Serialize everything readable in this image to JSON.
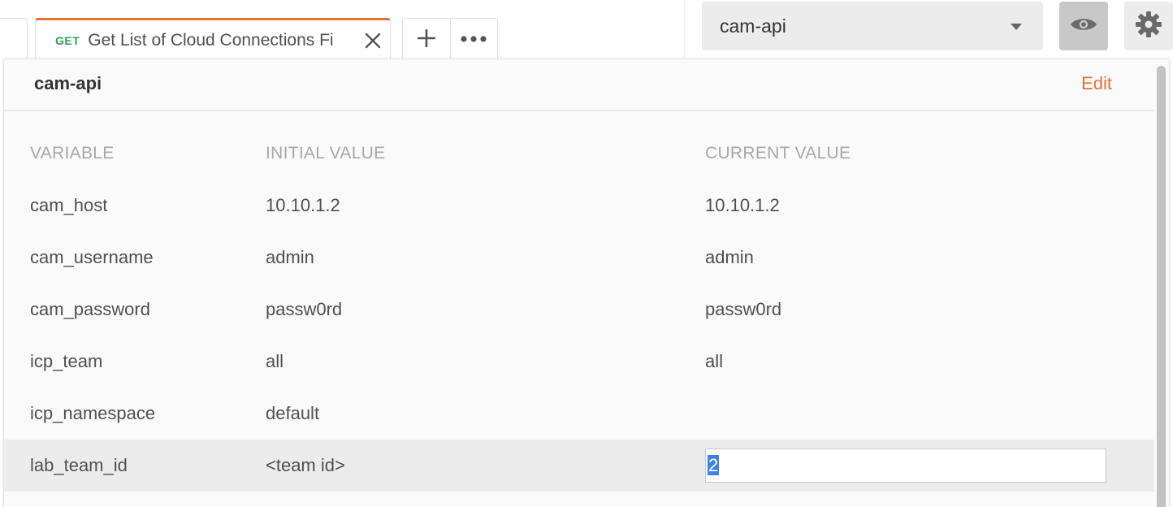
{
  "tabs": {
    "active": {
      "method": "GET",
      "title": "Get List of Cloud Connections Fi"
    }
  },
  "environment": {
    "selected": "cam-api"
  },
  "panel": {
    "title": "cam-api",
    "edit_label": "Edit",
    "columns": {
      "variable": "VARIABLE",
      "initial": "INITIAL VALUE",
      "current": "CURRENT VALUE"
    },
    "rows": [
      {
        "variable": "cam_host",
        "initial": "10.10.1.2",
        "current": "10.10.1.2"
      },
      {
        "variable": "cam_username",
        "initial": "admin",
        "current": "admin"
      },
      {
        "variable": "cam_password",
        "initial": "passw0rd",
        "current": "passw0rd"
      },
      {
        "variable": "icp_team",
        "initial": "all",
        "current": "all"
      },
      {
        "variable": "icp_namespace",
        "initial": "default",
        "current": ""
      },
      {
        "variable": "lab_team_id",
        "initial": "<team id>",
        "current": "2"
      }
    ]
  },
  "colors": {
    "accent": "#e8703a",
    "method_get": "#2aa05a",
    "selection": "#3b83e8"
  },
  "icons": [
    "close-icon",
    "plus-icon",
    "more-icon",
    "chevron-down-icon",
    "eye-icon",
    "gear-icon"
  ]
}
